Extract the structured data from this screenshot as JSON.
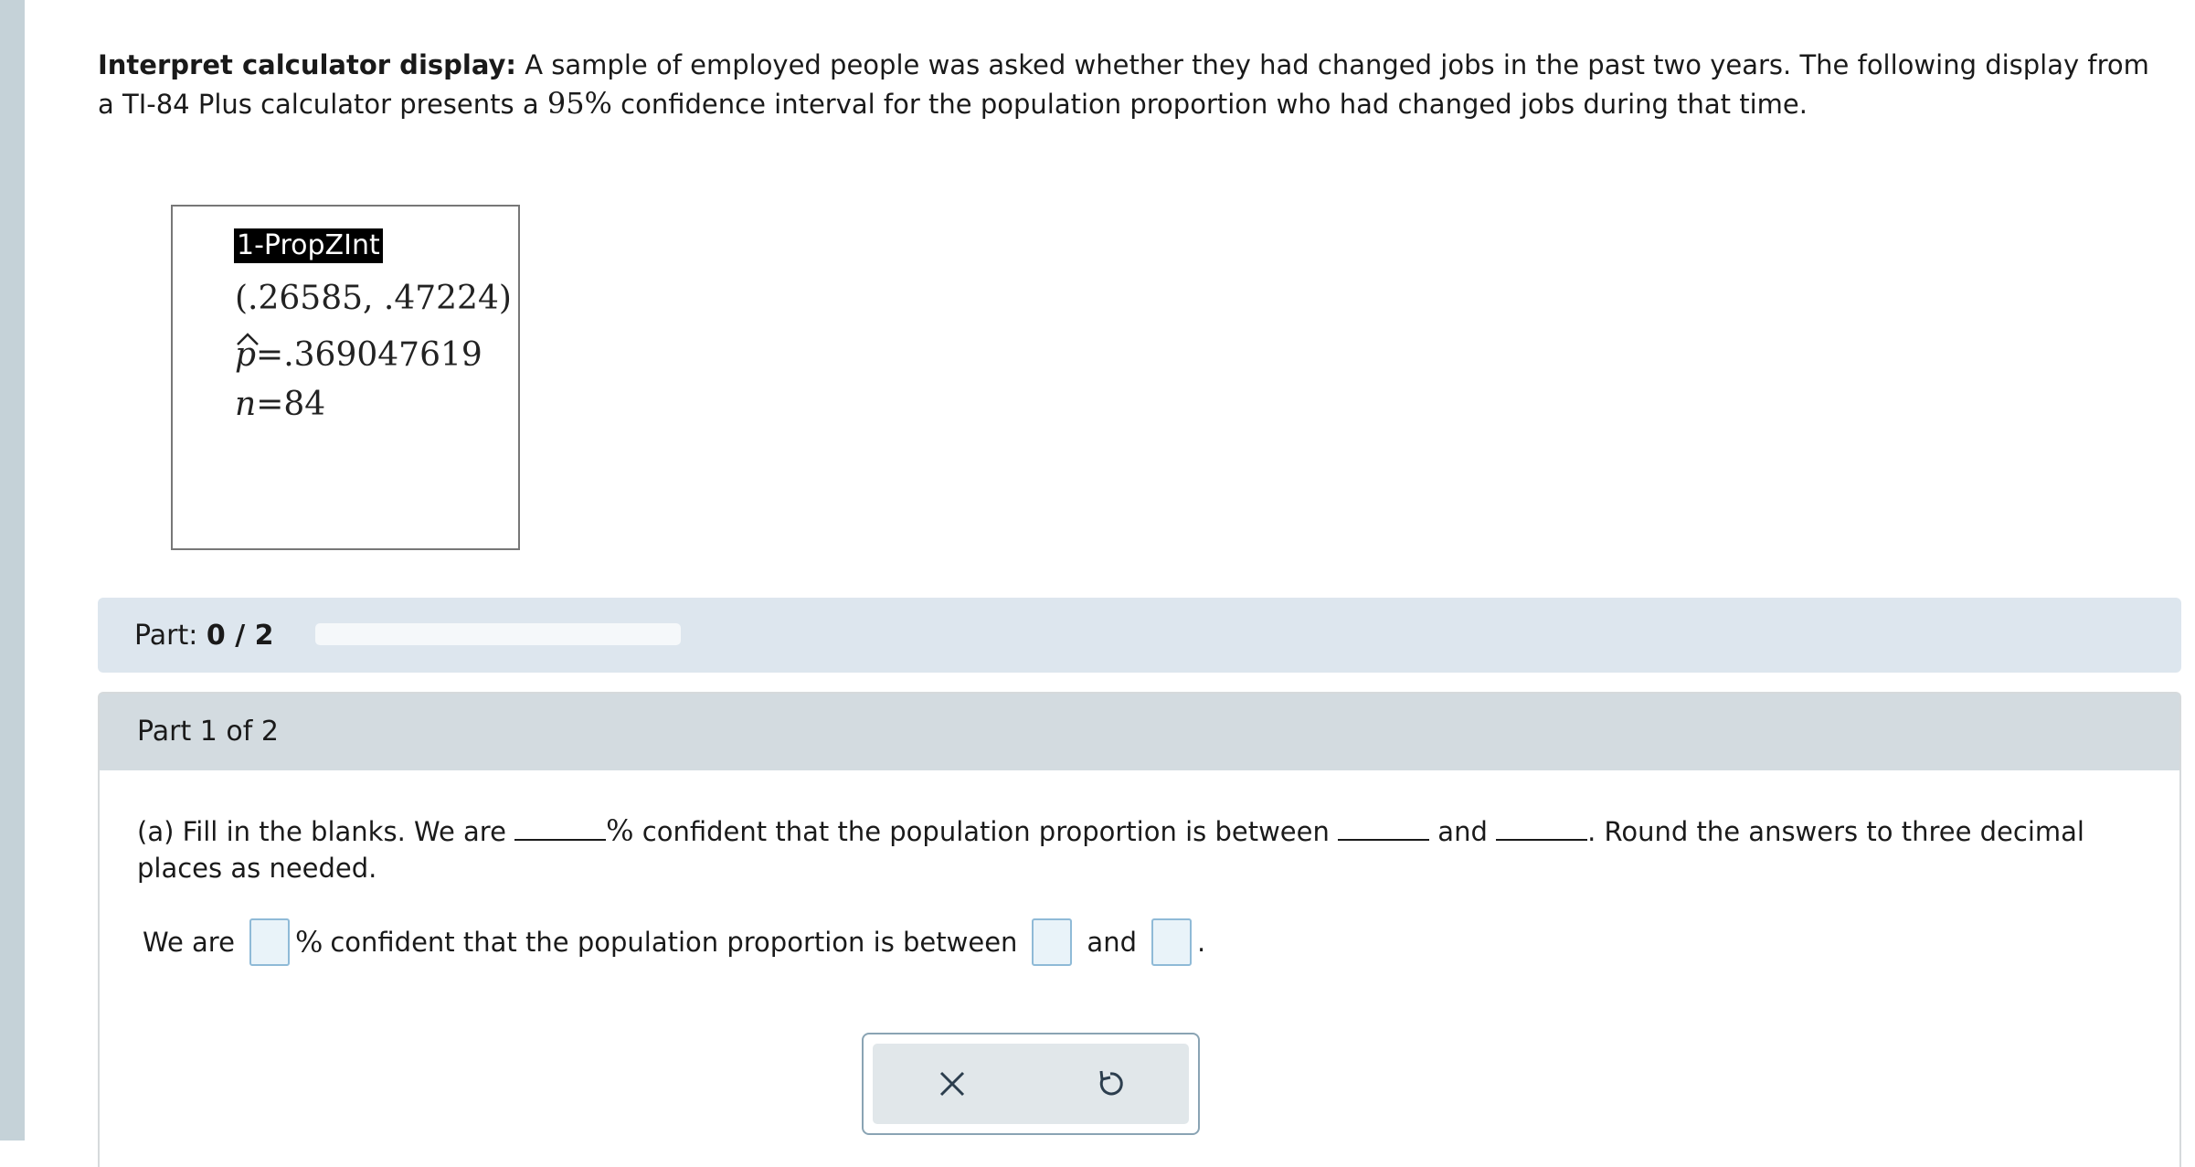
{
  "intro": {
    "label": "Interpret calculator display:",
    "text_before": "A sample of employed people was asked whether they had changed jobs in the past two years. The following display from a TI-84 Plus calculator presents a",
    "confidence": "95%",
    "text_after": "confidence interval for the population proportion who had changed jobs during that time."
  },
  "calculator": {
    "title": "1-PropZInt",
    "interval": "(.26585, .47224)",
    "phat_symbol": "p",
    "phat_value": "=.369047619",
    "n_symbol": "n",
    "n_value": "=84"
  },
  "progress": {
    "label": "Part:",
    "value": "0 / 2",
    "fraction": 0
  },
  "part": {
    "header": "Part 1 of 2",
    "question_a": "(a) Fill in the blanks. We are",
    "question_b": "confident that the population proportion is between",
    "question_c": "and",
    "question_d": ". Round the answers to three decimal places as needed.",
    "percent": "%",
    "answer_we_are": "We are",
    "answer_middle": "confident that the population proportion is between",
    "answer_and": "and",
    "answer_end": "."
  },
  "controls": {
    "clear_icon": "x-icon",
    "undo_icon": "undo-icon"
  }
}
